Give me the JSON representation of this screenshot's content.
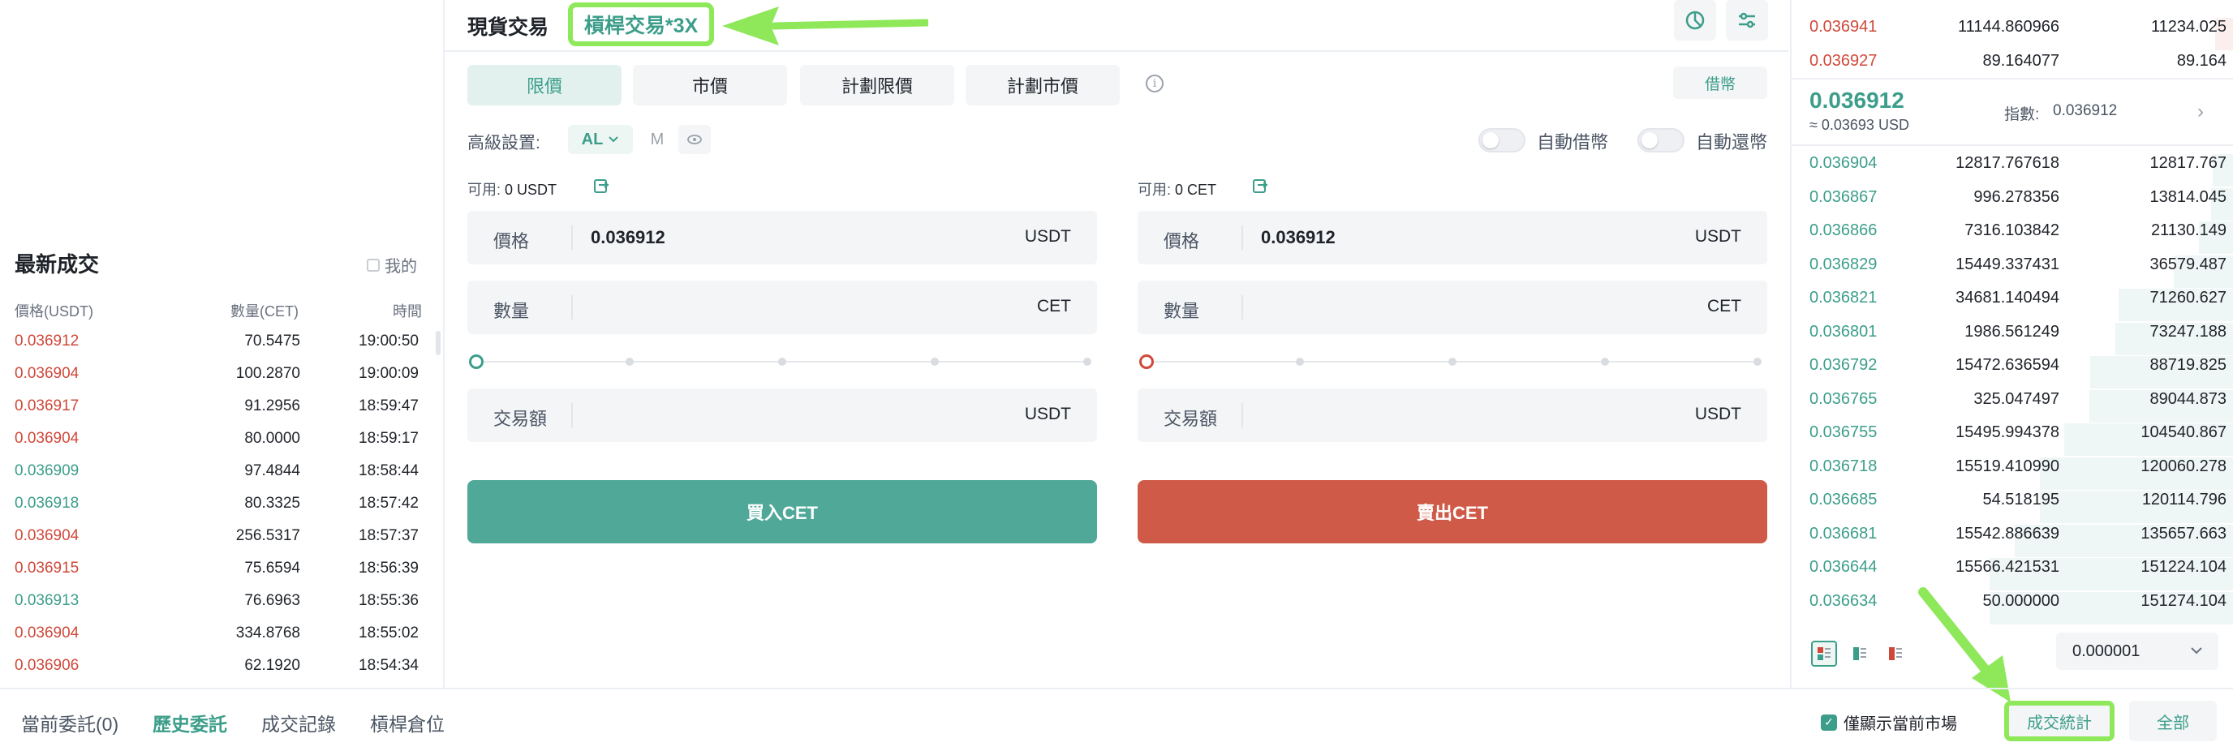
{
  "header": {
    "tab_spot": "現貨交易",
    "tab_margin": "槓桿交易*3X"
  },
  "order_types": [
    "限價",
    "市價",
    "計劃限價",
    "計劃市價"
  ],
  "borrow_label": "借幣",
  "advanced": {
    "label": "高級設置:",
    "al_label": "AL",
    "m_label": "M"
  },
  "toggles": {
    "auto_borrow": "自動借幣",
    "auto_repay": "自動還幣"
  },
  "buy": {
    "avail_label": "可用:",
    "avail_value": "0 USDT",
    "price_label": "價格",
    "price_value": "0.036912",
    "price_unit": "USDT",
    "amount_label": "數量",
    "amount_unit": "CET",
    "total_label": "交易額",
    "total_unit": "USDT",
    "button": "買入CET"
  },
  "sell": {
    "avail_label": "可用:",
    "avail_value": "0 CET",
    "price_label": "價格",
    "price_value": "0.036912",
    "price_unit": "USDT",
    "amount_label": "數量",
    "amount_unit": "CET",
    "total_label": "交易額",
    "total_unit": "USDT",
    "button": "賣出CET"
  },
  "trades": {
    "title": "最新成交",
    "mine_label": "我的",
    "col_price": "價格(USDT)",
    "col_amount": "數量(CET)",
    "col_time": "時間",
    "rows": [
      {
        "price": "0.036912",
        "amount": "70.5475",
        "time": "19:00:50",
        "side": "dn"
      },
      {
        "price": "0.036904",
        "amount": "100.2870",
        "time": "19:00:09",
        "side": "dn"
      },
      {
        "price": "0.036917",
        "amount": "91.2956",
        "time": "18:59:47",
        "side": "dn"
      },
      {
        "price": "0.036904",
        "amount": "80.0000",
        "time": "18:59:17",
        "side": "dn"
      },
      {
        "price": "0.036909",
        "amount": "97.4844",
        "time": "18:58:44",
        "side": "up"
      },
      {
        "price": "0.036918",
        "amount": "80.3325",
        "time": "18:57:42",
        "side": "up"
      },
      {
        "price": "0.036904",
        "amount": "256.5317",
        "time": "18:57:37",
        "side": "dn"
      },
      {
        "price": "0.036915",
        "amount": "75.6594",
        "time": "18:56:39",
        "side": "dn"
      },
      {
        "price": "0.036913",
        "amount": "76.6963",
        "time": "18:55:36",
        "side": "up"
      },
      {
        "price": "0.036904",
        "amount": "334.8768",
        "time": "18:55:02",
        "side": "dn"
      },
      {
        "price": "0.036906",
        "amount": "62.1920",
        "time": "18:54:34",
        "side": "dn"
      }
    ]
  },
  "orderbook": {
    "asks": [
      {
        "price": "0.036941",
        "amount": "11144.860966",
        "total": "11234.025"
      },
      {
        "price": "0.036927",
        "amount": "89.164077",
        "total": "89.164"
      }
    ],
    "last_price": "0.036912",
    "last_usd": "≈ 0.03693 USD",
    "index_label": "指數:",
    "index_value": "0.036912",
    "bids": [
      {
        "price": "0.036904",
        "amount": "12817.767618",
        "total": "12817.767"
      },
      {
        "price": "0.036867",
        "amount": "996.278356",
        "total": "13814.045"
      },
      {
        "price": "0.036866",
        "amount": "7316.103842",
        "total": "21130.149"
      },
      {
        "price": "0.036829",
        "amount": "15449.337431",
        "total": "36579.487"
      },
      {
        "price": "0.036821",
        "amount": "34681.140494",
        "total": "71260.627"
      },
      {
        "price": "0.036801",
        "amount": "1986.561249",
        "total": "73247.188"
      },
      {
        "price": "0.036792",
        "amount": "15472.636594",
        "total": "88719.825"
      },
      {
        "price": "0.036765",
        "amount": "325.047497",
        "total": "89044.873"
      },
      {
        "price": "0.036755",
        "amount": "15495.994378",
        "total": "104540.867"
      },
      {
        "price": "0.036718",
        "amount": "15519.410990",
        "total": "120060.278"
      },
      {
        "price": "0.036685",
        "amount": "54.518195",
        "total": "120114.796"
      },
      {
        "price": "0.036681",
        "amount": "15542.886639",
        "total": "135657.663"
      },
      {
        "price": "0.036644",
        "amount": "15566.421531",
        "total": "151224.104"
      },
      {
        "price": "0.036634",
        "amount": "50.000000",
        "total": "151274.104"
      }
    ],
    "precision": "0.000001"
  },
  "bottom": {
    "tabs": [
      "當前委託(0)",
      "歷史委託",
      "成交記錄",
      "槓桿倉位"
    ],
    "only_current": "僅顯示當前市場",
    "stats_button": "成交統計",
    "all_button": "全部"
  },
  "colors": {
    "green": "#3c9e8a",
    "red": "#d0483a",
    "buy_button": "#4fa898",
    "sell_button": "#cf5a47",
    "annotation": "#8ee85a"
  }
}
